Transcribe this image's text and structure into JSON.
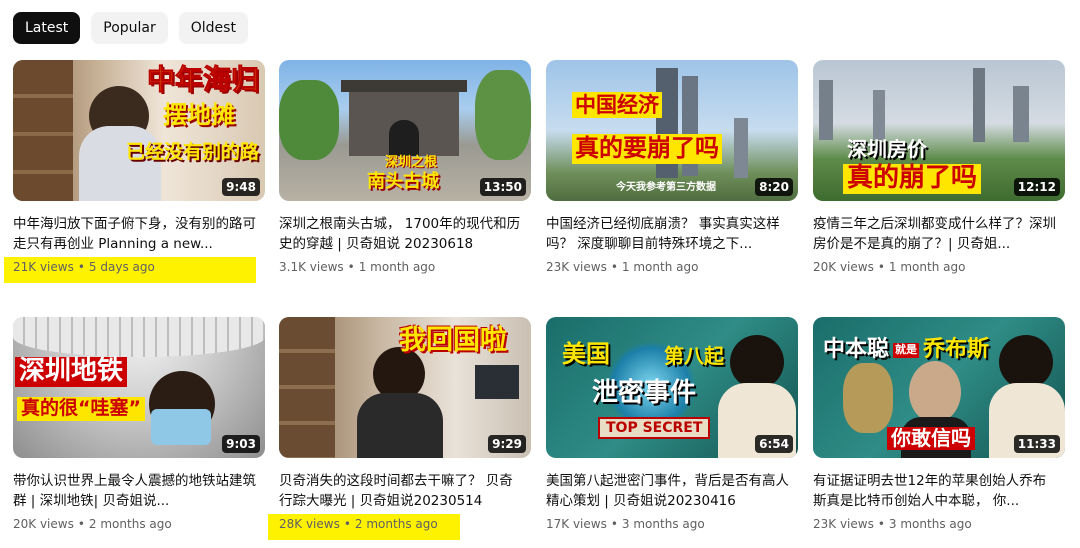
{
  "filters": [
    "Latest",
    "Popular",
    "Oldest"
  ],
  "videos": [
    {
      "title": "中年海归放下面子俯下身，没有别的路可走只有再创业 Planning a new...",
      "views": "21K views",
      "age": "5 days ago",
      "duration": "9:48",
      "overlay": [
        "中年海归",
        "摆地摊",
        "已经没有别的路"
      ]
    },
    {
      "title": "深圳之根南头古城， 1700年的现代和历史的穿越 | 贝奇姐说 20230618",
      "views": "3.1K views",
      "age": "1 month ago",
      "duration": "13:50",
      "overlay": [
        "深圳之根",
        "南头古城"
      ]
    },
    {
      "title": "中国经济已经彻底崩溃？ 事实真实这样吗？ 深度聊聊目前特殊环境之下...",
      "views": "23K views",
      "age": "1 month ago",
      "duration": "8:20",
      "overlay": [
        "中国经济",
        "真的要崩了吗",
        "今天我参考第三方数据"
      ]
    },
    {
      "title": "疫情三年之后深圳都变成什么样了？深圳房价是不是真的崩了？| 贝奇姐...",
      "views": "20K views",
      "age": "1 month ago",
      "duration": "12:12",
      "overlay": [
        "深圳房价",
        "真的崩了吗"
      ]
    },
    {
      "title": "带你认识世界上最令人震撼的地铁站建筑群 | 深圳地铁| 贝奇姐说...",
      "views": "20K views",
      "age": "2 months ago",
      "duration": "9:03",
      "overlay": [
        "深圳地铁",
        "真的很“哇塞”"
      ]
    },
    {
      "title": "贝奇消失的这段时间都去干嘛了？ 贝奇行踪大曝光 | 贝奇姐说20230514",
      "views": "28K views",
      "age": "2 months ago",
      "duration": "9:29",
      "overlay": [
        "我回国啦"
      ]
    },
    {
      "title": "美国第八起泄密门事件，背后是否有高人精心策划 | 贝奇姐说20230416",
      "views": "17K views",
      "age": "3 months ago",
      "duration": "6:54",
      "overlay": [
        "美国",
        "第八起",
        "泄密事件",
        "TOP SECRET"
      ]
    },
    {
      "title": "有证据证明去世12年的苹果创始人乔布斯真是比特币创始人中本聪， 你...",
      "views": "23K views",
      "age": "3 months ago",
      "duration": "11:33",
      "overlay": [
        "中本聪",
        "就是",
        "乔布斯",
        "你敢信吗"
      ]
    }
  ],
  "colors": {
    "highlight": "#fff200",
    "chip_active_bg": "#0f0f0f",
    "chip_bg": "#f2f2f2",
    "meta": "#606060"
  }
}
